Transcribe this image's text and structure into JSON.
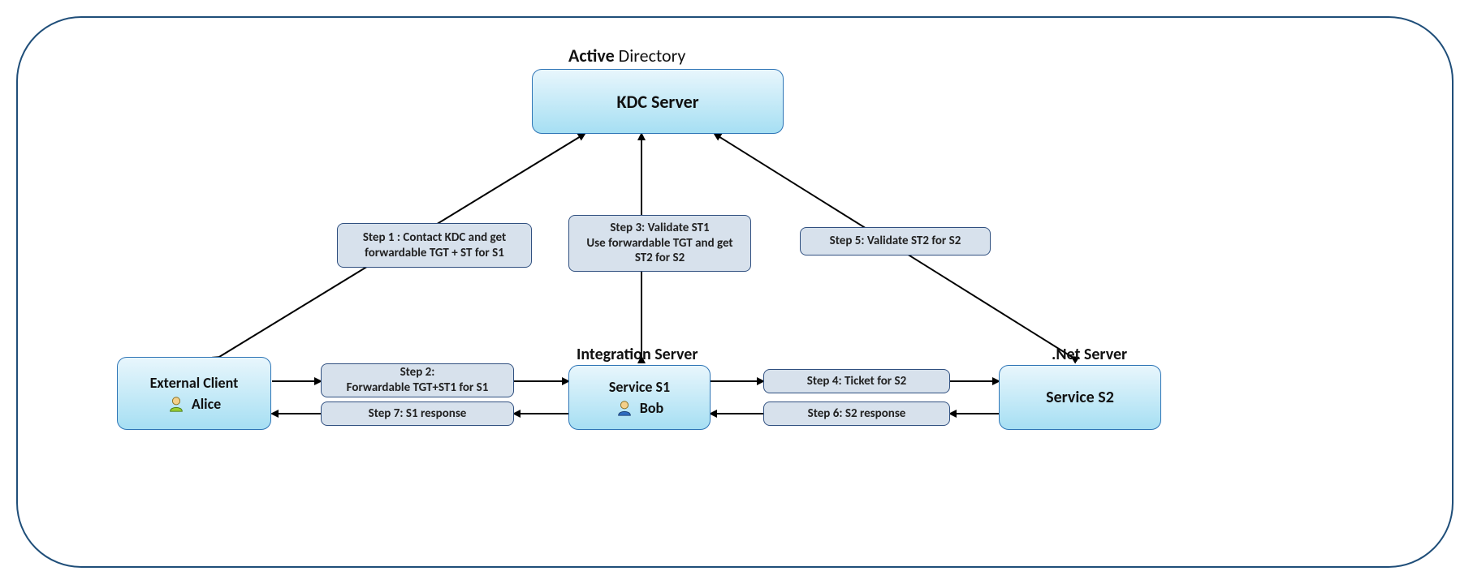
{
  "title": {
    "bold": "Active",
    "rest": " Directory"
  },
  "kdc": {
    "label": "KDC Server"
  },
  "external": {
    "title": "External  Client",
    "user": "Alice"
  },
  "integration": {
    "title": "Integration Server",
    "service": "Service S1",
    "user": "Bob"
  },
  "netserver": {
    "title": ".Net Server",
    "service": "Service S2"
  },
  "steps": {
    "s1": "Step 1   : Contact KDC and get forwardable TGT + ST for S1",
    "s2a": "Step 2:",
    "s2b": "Forwardable TGT+ST1 for S1",
    "s3": "Step 3:   Validate ST1\nUse forwardable TGT and get ST2 for S2",
    "s4": "Step 4:   Ticket for S2",
    "s5": "Step 5:   Validate ST2 for S2",
    "s6": "Step 6:   S2 response",
    "s7": "Step 7: S1 response"
  }
}
